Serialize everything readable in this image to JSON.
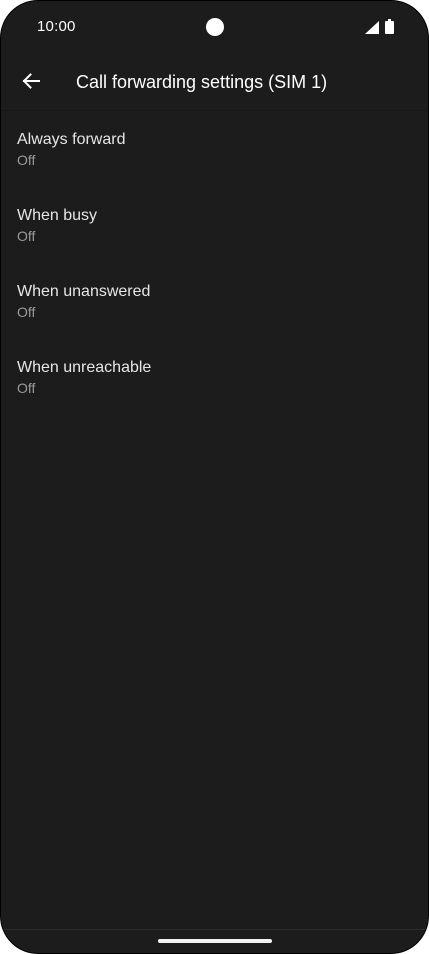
{
  "status_bar": {
    "time": "10:00",
    "icons": [
      "camera-cutout",
      "signal-icon",
      "battery-icon"
    ]
  },
  "app_bar": {
    "back_icon": "arrow-left-icon",
    "title": "Call forwarding settings (SIM 1)"
  },
  "settings": {
    "items": [
      {
        "title": "Always forward",
        "summary": "Off"
      },
      {
        "title": "When busy",
        "summary": "Off"
      },
      {
        "title": "When unanswered",
        "summary": "Off"
      },
      {
        "title": "When unreachable",
        "summary": "Off"
      }
    ]
  },
  "colors": {
    "background": "#1c1c1c",
    "title_text": "#ffffff",
    "item_text": "#e6e6e6",
    "summary_text": "#9a9a9a"
  }
}
